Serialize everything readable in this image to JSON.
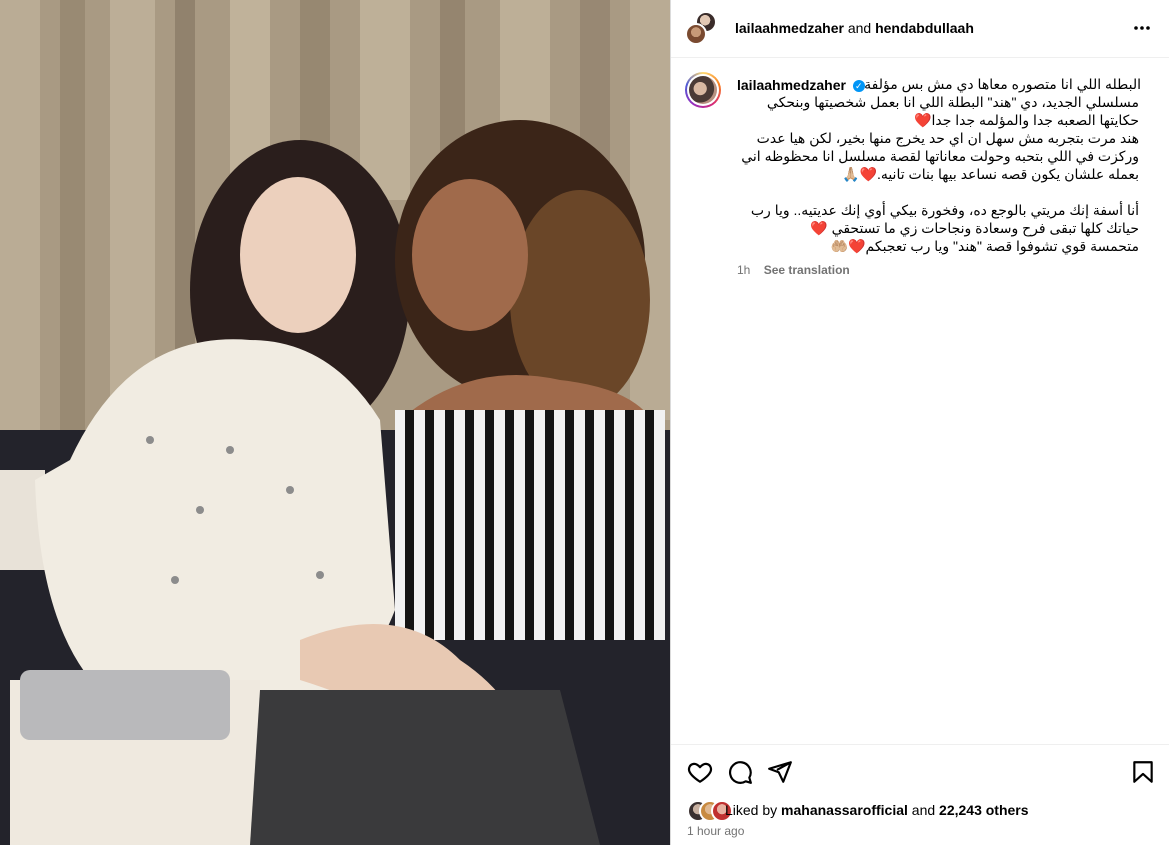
{
  "header": {
    "user1": "lailaahmedzaher",
    "joiner": "and",
    "user2": "hendabdullaah",
    "more_icon": "more-horizontal-icon"
  },
  "caption": {
    "username": "lailaahmedzaher",
    "verified_icon": "verified-badge-icon",
    "lines": [
      "البطله اللي انا متصوره معاها دي مش بس مؤلفة",
      "مسلسلي الجديد، دي \"هند\" البطلة اللي انا بعمل شخصيتها وبنحكي",
      "حكايتها الصعبه جدا والمؤلمه جدا جدا❤️",
      "هند مرت بتجربه مش سهل ان اي حد يخرج منها بخير، لكن هيا عدت",
      "وركزت في اللي بتحبه وحولت معاناتها لقصة مسلسل انا محظوظه اني",
      "بعمله علشان يكون قصه نساعد بيها بنات تانيه.❤️🙏🏼",
      "",
      "أنا أسفة إنك مريتي بالوجع ده، وفخورة بيكي أوي إنك عديتيه.. ويا رب",
      "حياتك كلها تبقى فرح وسعادة ونجاحات زي ما تستحقي ❤️",
      "متحمسة قوي تشوفوا قصة \"هند\" ويا رب تعجبكم❤️🤲🏼"
    ],
    "time": "1h",
    "see_translation": "See translation"
  },
  "actions": {
    "like_icon": "heart-icon",
    "comment_icon": "comment-icon",
    "share_icon": "share-icon",
    "save_icon": "bookmark-icon"
  },
  "likes": {
    "prefix": "Liked by",
    "user": "mahanassarofficial",
    "middle": "and",
    "count": "22,243 others"
  },
  "posted": "1 hour ago"
}
